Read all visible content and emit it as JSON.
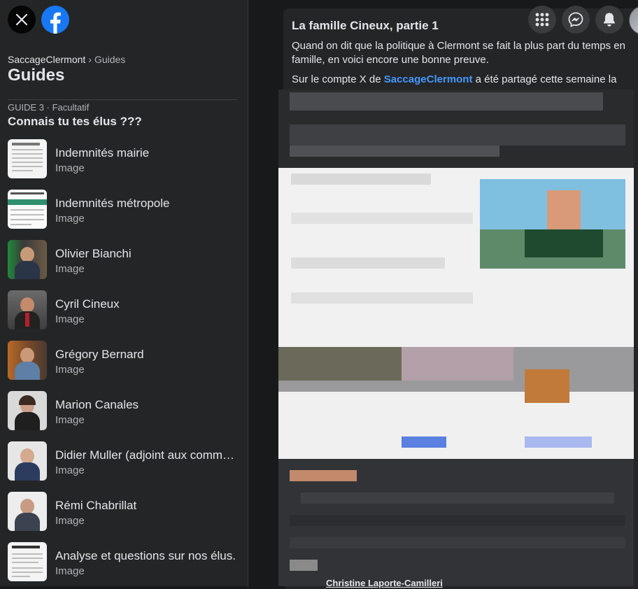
{
  "header": {
    "close_icon": "close-icon",
    "logo": "facebook-logo"
  },
  "breadcrumb": {
    "group": "SaccageClermont",
    "separator": "›",
    "section": "Guides"
  },
  "page_title": "Guides",
  "guide": {
    "meta": "GUIDE 3 · Facultatif",
    "title": "Connais tu tes élus ???"
  },
  "items": [
    {
      "title": "Indemnités mairie",
      "subtitle": "Image"
    },
    {
      "title": "Indemnités métropole",
      "subtitle": "Image"
    },
    {
      "title": "Olivier Bianchi",
      "subtitle": "Image"
    },
    {
      "title": "Cyril Cineux",
      "subtitle": "Image"
    },
    {
      "title": "Grégory Bernard",
      "subtitle": "Image"
    },
    {
      "title": "Marion Canales",
      "subtitle": "Image"
    },
    {
      "title": "Didier Muller (adjoint aux commerces)",
      "subtitle": "Image"
    },
    {
      "title": "Rémi Chabrillat",
      "subtitle": "Image"
    },
    {
      "title": "Analyse et questions sur nos élus.",
      "subtitle": "Image"
    }
  ],
  "top_icons": [
    "menu-grid-icon",
    "messenger-icon",
    "bell-icon"
  ],
  "post": {
    "title": "La famille Cineux, partie 1",
    "p1": "Quand on dit que la politique à Clermont se fait la plus part du temps en famille, en voici encore une bonne preuve.",
    "p2_before": "Sur le compte X de ",
    "p2_mention": "SaccageClermont",
    "p2_after": " a été partagé cette semaine la",
    "caption_name": "Christine Laporte-Camilleri"
  },
  "colors": {
    "background": "#18191a",
    "panel": "#242526",
    "link": "#4599ff",
    "facebook_blue": "#1877f2"
  }
}
